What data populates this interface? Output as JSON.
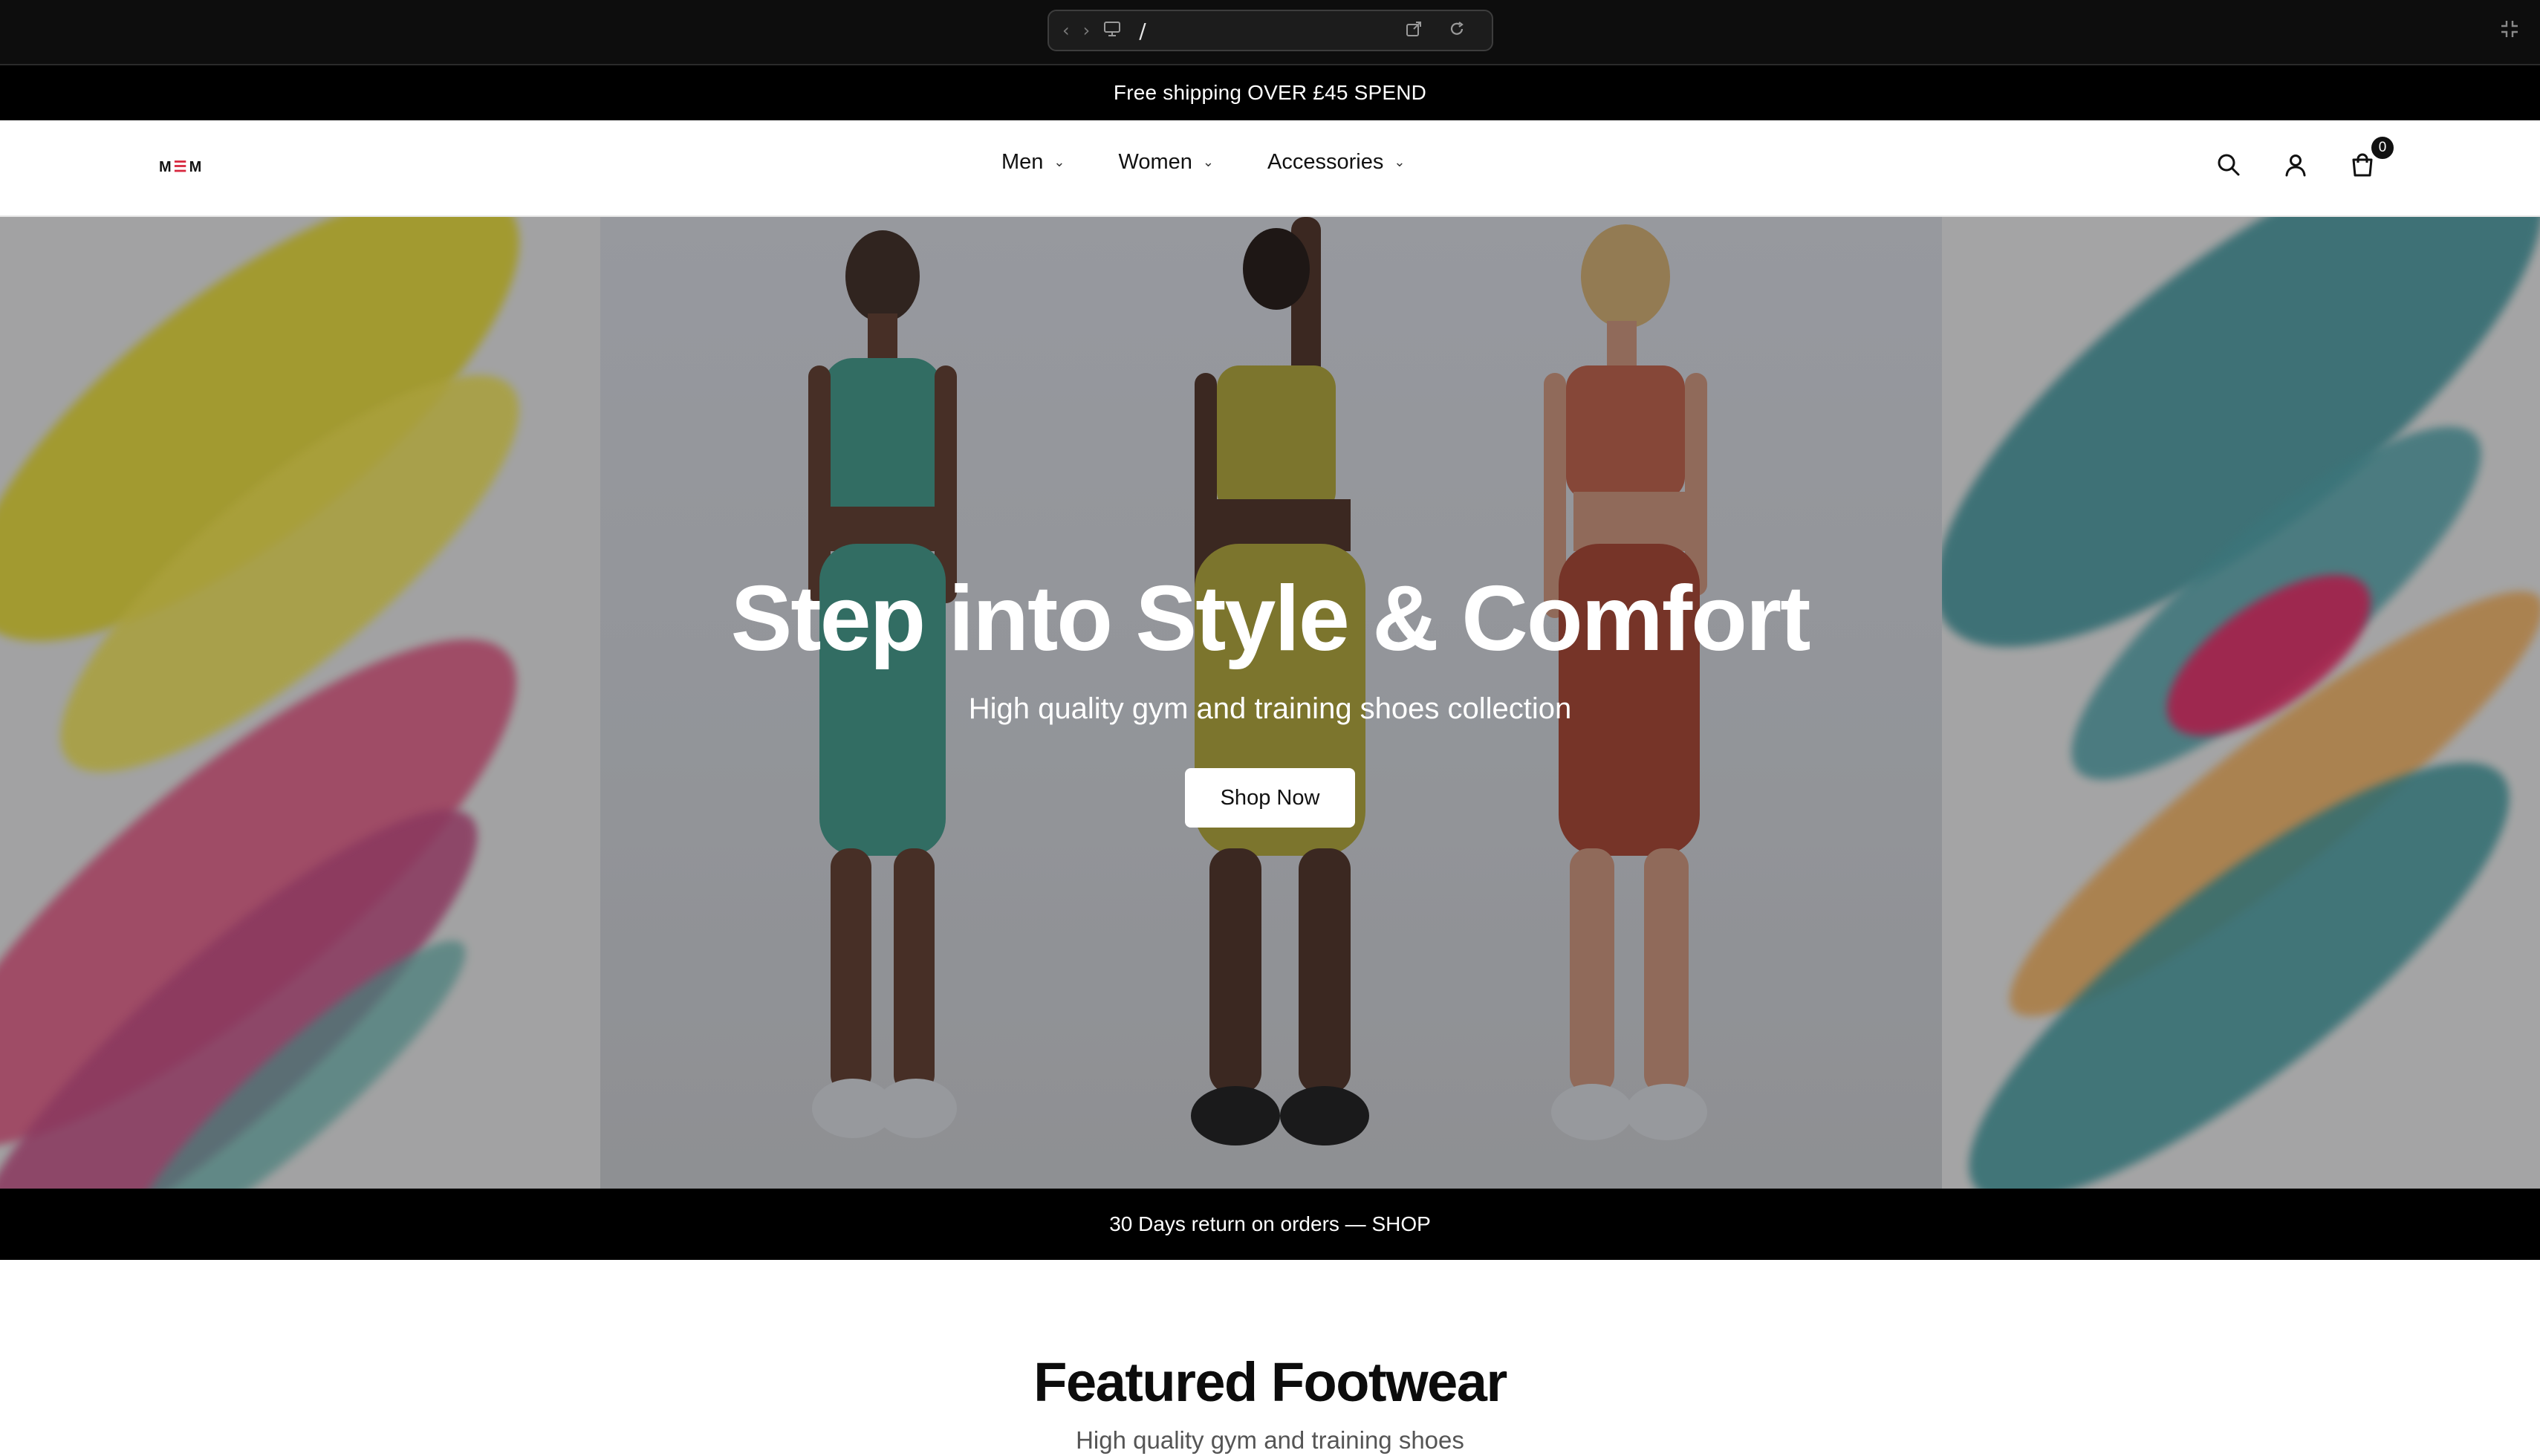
{
  "browser": {
    "url": "/",
    "icons": [
      "back-icon",
      "forward-icon",
      "monitor-icon",
      "open-external-icon",
      "reload-icon",
      "collapse-icon"
    ]
  },
  "announcement": {
    "text": "Free shipping OVER £45 SPEND"
  },
  "header": {
    "logo": {
      "left": "M",
      "mid": "☰",
      "right": "M"
    },
    "nav": [
      {
        "label": "Men"
      },
      {
        "label": "Women"
      },
      {
        "label": "Accessories"
      }
    ],
    "cart_count": "0",
    "icons": [
      "search-icon",
      "account-icon",
      "cart-icon"
    ]
  },
  "hero": {
    "title": "Step into Style & Comfort",
    "subtitle": "High quality gym and training shoes collection",
    "cta_label": "Shop Now"
  },
  "return_bar": {
    "text": "30 Days return on orders — SHOP"
  },
  "featured": {
    "title": "Featured Footwear",
    "subtitle": "High quality gym and training shoes"
  },
  "colors": {
    "black": "#000000",
    "white": "#ffffff",
    "accent_red": "#d7263d"
  }
}
